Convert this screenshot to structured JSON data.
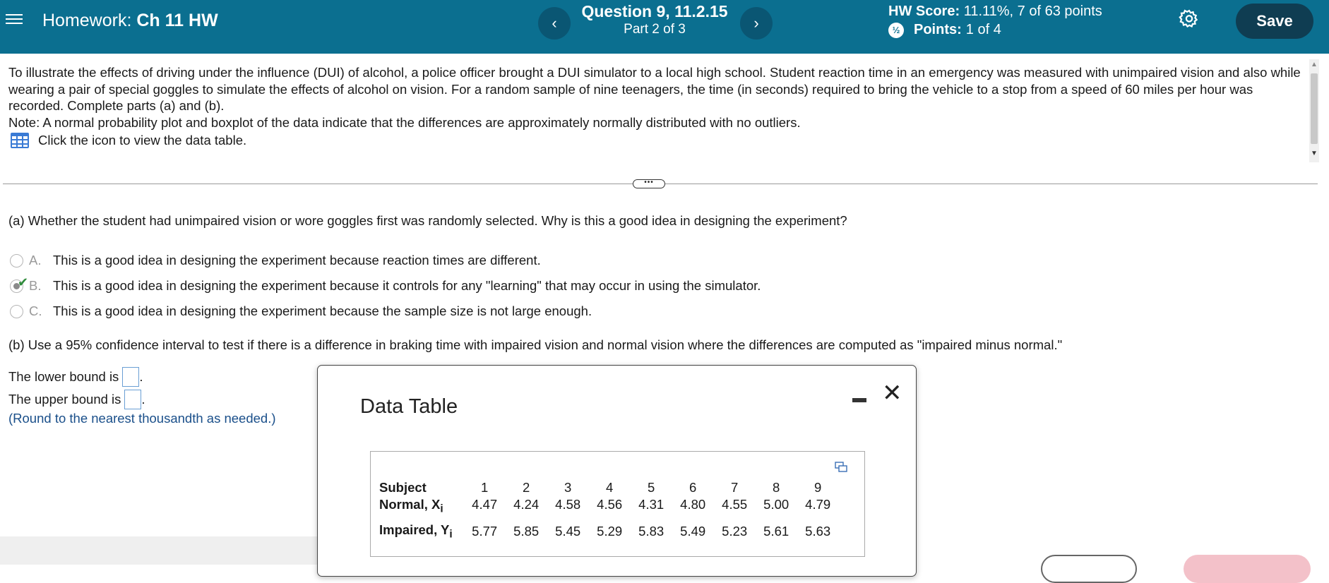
{
  "header": {
    "homework_label": "Homework:",
    "homework_name": "Ch 11 HW",
    "question_title": "Question 9, 11.2.15",
    "question_part": "Part 2 of 3",
    "hw_score_label": "HW Score:",
    "hw_score_value": "11.11%, 7 of 63 points",
    "points_label": "Points:",
    "points_value": "1 of 4",
    "partial_icon_glyph": "½",
    "save_label": "Save",
    "prev_glyph": "‹",
    "next_glyph": "›",
    "colors": {
      "bar": "#0b6f90",
      "save": "#0f3d52"
    }
  },
  "stem": {
    "paragraph": "To illustrate the effects of driving under the influence (DUI) of alcohol, a police officer brought a DUI simulator to a local high school. Student reaction time in an emergency was measured with unimpaired vision and also while wearing a pair of special goggles to simulate the effects of alcohol on vision. For a random sample of nine teenagers, the time (in seconds) required to bring the vehicle to a stop from a speed of 60 miles per hour was recorded. Complete parts (a) and (b).",
    "note": "Note: A normal probability plot and boxplot of the data indicate that the differences are approximately normally distributed with no outliers.",
    "data_link": "Click the icon to view the data table."
  },
  "divider_handle": "•••",
  "part_a": {
    "question": "(a) Whether the student had unimpaired vision or wore goggles first was randomly selected. Why is this a good idea in designing the experiment?",
    "options": [
      {
        "letter": "A.",
        "text": "This is a good idea in designing the experiment because reaction times are different."
      },
      {
        "letter": "B.",
        "text": "This is a good idea in designing the experiment because it controls for any \"learning\" that may occur in using the simulator."
      },
      {
        "letter": "C.",
        "text": "This is a good idea in designing the experiment because the sample size is not large enough."
      }
    ],
    "selected": "B",
    "correct_mark": "✔"
  },
  "part_b": {
    "question": "(b) Use a 95% confidence interval to test if there is a difference in braking time with impaired vision and normal vision where the differences are computed as \"impaired minus normal.\"",
    "lower_label": "The lower bound is",
    "upper_label": "The upper bound is",
    "punct": ".",
    "round_note": "(Round to the nearest thousandth as needed.)"
  },
  "data_table": {
    "title": "Data Table",
    "close_glyph": "✕",
    "row_labels": [
      "Subject",
      "Normal, X",
      "Impaired, Y"
    ],
    "subscript": "i",
    "subjects": [
      "1",
      "2",
      "3",
      "4",
      "5",
      "6",
      "7",
      "8",
      "9"
    ],
    "normal": [
      "4.47",
      "4.24",
      "4.58",
      "4.56",
      "4.31",
      "4.80",
      "4.55",
      "5.00",
      "4.79"
    ],
    "impaired": [
      "5.77",
      "5.85",
      "5.45",
      "5.29",
      "5.83",
      "5.49",
      "5.23",
      "5.61",
      "5.63"
    ]
  }
}
